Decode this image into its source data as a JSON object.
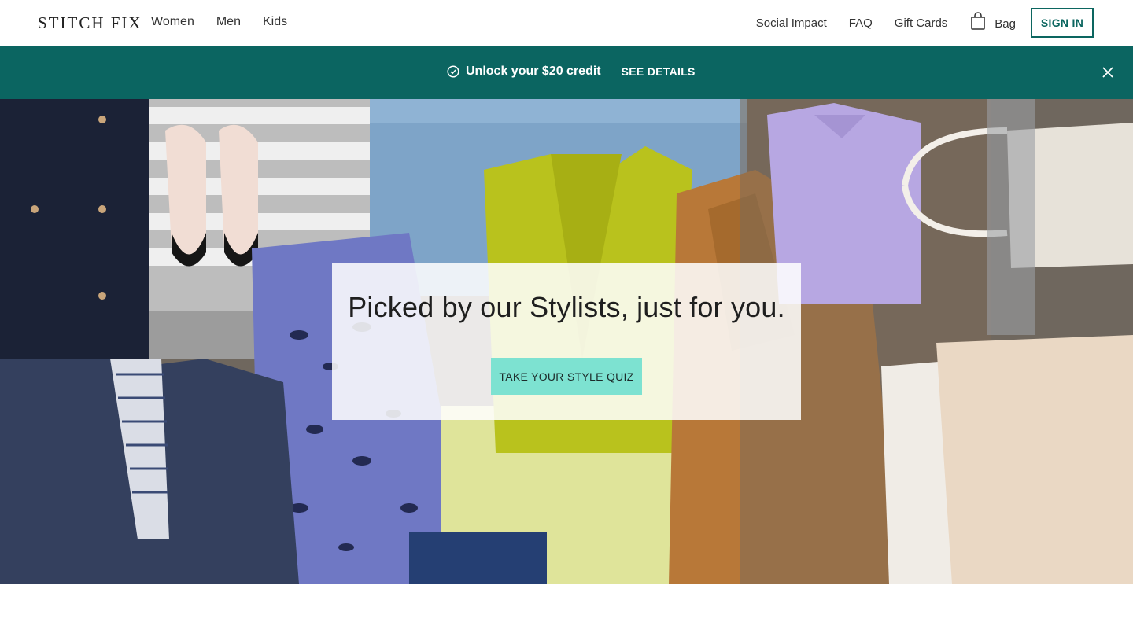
{
  "header": {
    "logo": "STITCH FIX",
    "nav_left": [
      "Women",
      "Men",
      "Kids"
    ],
    "nav_right": [
      "Social Impact",
      "FAQ",
      "Gift Cards"
    ],
    "bag_label": "Bag",
    "signin_label": "SIGN IN"
  },
  "banner": {
    "message": "Unlock your $20 credit",
    "link": "SEE DETAILS",
    "icons": [
      "check-circle-icon",
      "close-icon"
    ]
  },
  "hero": {
    "headline": "Picked by our Stylists, just for you.",
    "cta_label": "TAKE YOUR STYLE QUIZ"
  },
  "colors": {
    "brand_teal": "#0b6561",
    "cta_mint": "#7de2d1"
  }
}
